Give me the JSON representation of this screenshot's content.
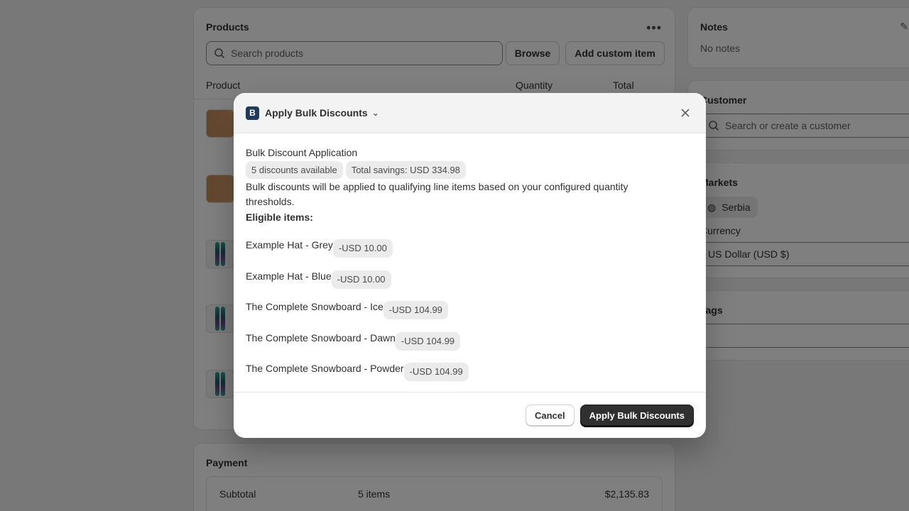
{
  "products": {
    "title": "Products",
    "search_placeholder": "Search products",
    "browse_label": "Browse",
    "add_custom_label": "Add custom item",
    "col_product": "Product",
    "col_quantity": "Quantity",
    "col_total": "Total"
  },
  "payment": {
    "title": "Payment",
    "subtotal_label": "Subtotal",
    "subtotal_items": "5 items",
    "subtotal_amount": "$2,135.83"
  },
  "notes": {
    "title": "Notes",
    "value": "No notes"
  },
  "customer": {
    "title": "Customer",
    "search_placeholder": "Search or create a customer"
  },
  "markets": {
    "title": "Markets",
    "market": "Serbia",
    "currency_label": "Currency",
    "currency_value": "US Dollar (USD $)"
  },
  "tags": {
    "title": "Tags"
  },
  "modal": {
    "app_title": "Apply Bulk Discounts",
    "heading": "Bulk Discount Application",
    "badge_available": "5 discounts available",
    "badge_savings": "Total savings: USD 334.98",
    "description": "Bulk discounts will be applied to qualifying line items based on your configured quantity thresholds.",
    "eligible_label": "Eligible items:",
    "items": [
      {
        "name": "Example Hat - Grey",
        "discount": "-USD 10.00"
      },
      {
        "name": "Example Hat - Blue",
        "discount": "-USD 10.00"
      },
      {
        "name": "The Complete Snowboard - Ice",
        "discount": "-USD 104.99"
      },
      {
        "name": "The Complete Snowboard - Dawn",
        "discount": "-USD 104.99"
      },
      {
        "name": "The Complete Snowboard - Powder",
        "discount": "-USD 104.99"
      }
    ],
    "cancel_label": "Cancel",
    "apply_label": "Apply Bulk Discounts"
  }
}
